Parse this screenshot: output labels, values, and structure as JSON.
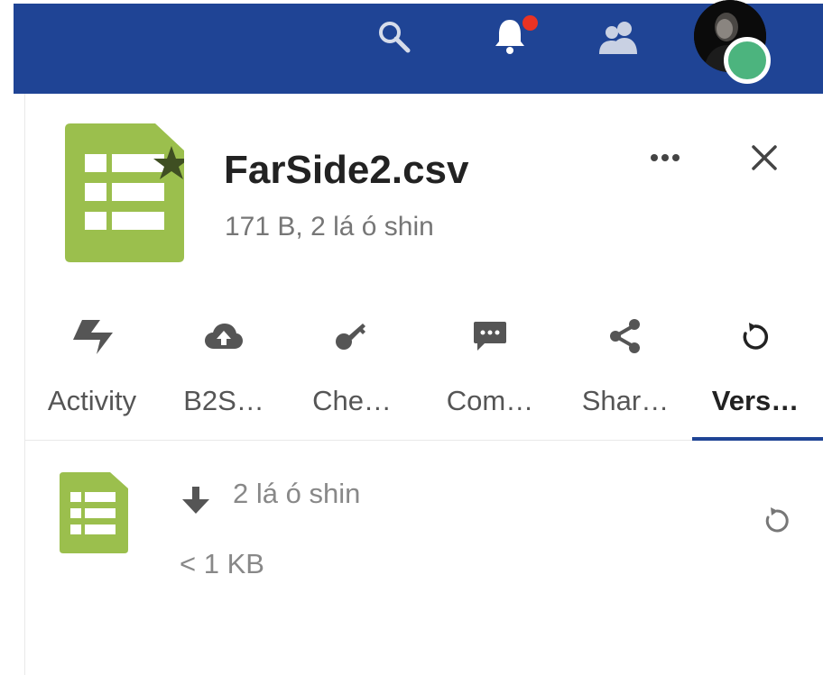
{
  "header": {
    "background": "#1f4495",
    "icons": [
      "search-icon",
      "bell-icon",
      "contacts-icon",
      "avatar"
    ],
    "notification_dot_color": "#ea3323",
    "status_color": "#4cb47e"
  },
  "file": {
    "name": "FarSide2.csv",
    "meta": "171 B, 2 lá ó shin",
    "icon": "spreadsheet-icon",
    "icon_color": "#9bbf4d",
    "favorite": true
  },
  "tabs": [
    {
      "label": "Activity",
      "icon": "activity-icon",
      "active": false
    },
    {
      "label": "B2S…",
      "icon": "cloud-upload-icon",
      "active": false
    },
    {
      "label": "Che…",
      "icon": "key-icon",
      "active": false
    },
    {
      "label": "Com…",
      "icon": "comment-icon",
      "active": false
    },
    {
      "label": "Shar…",
      "icon": "share-icon",
      "active": false
    },
    {
      "label": "Vers…",
      "icon": "history-icon",
      "active": true
    }
  ],
  "accent": "#1f4495",
  "versions": [
    {
      "date": "2 lá ó shin",
      "size": "< 1 KB",
      "icon": "spreadsheet-icon"
    }
  ]
}
